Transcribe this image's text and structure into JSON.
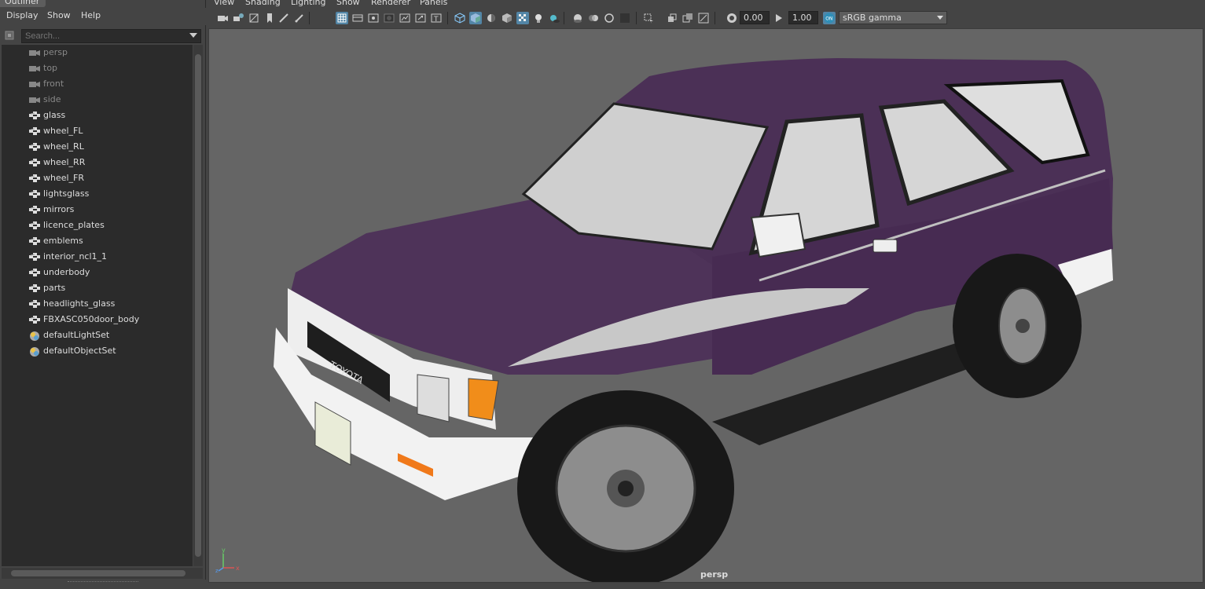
{
  "outliner": {
    "tab_title": "Outliner",
    "menu": [
      "Display",
      "Show",
      "Help"
    ],
    "search_placeholder": "Search...",
    "items": [
      {
        "label": "persp",
        "icon": "camera-icon",
        "dim": true
      },
      {
        "label": "top",
        "icon": "camera-icon",
        "dim": true
      },
      {
        "label": "front",
        "icon": "camera-icon",
        "dim": true
      },
      {
        "label": "side",
        "icon": "camera-icon",
        "dim": true
      },
      {
        "label": "glass",
        "icon": "transform-group-icon",
        "dim": false
      },
      {
        "label": "wheel_FL",
        "icon": "transform-group-icon",
        "dim": false
      },
      {
        "label": "wheel_RL",
        "icon": "transform-group-icon",
        "dim": false
      },
      {
        "label": "wheel_RR",
        "icon": "transform-group-icon",
        "dim": false
      },
      {
        "label": "wheel_FR",
        "icon": "transform-group-icon",
        "dim": false
      },
      {
        "label": "lightsglass",
        "icon": "transform-group-icon",
        "dim": false
      },
      {
        "label": "mirrors",
        "icon": "transform-group-icon",
        "dim": false
      },
      {
        "label": "licence_plates",
        "icon": "transform-group-icon",
        "dim": false
      },
      {
        "label": "emblems",
        "icon": "transform-group-icon",
        "dim": false
      },
      {
        "label": "interior_ncl1_1",
        "icon": "transform-group-icon",
        "dim": false
      },
      {
        "label": "underbody",
        "icon": "transform-group-icon",
        "dim": false
      },
      {
        "label": "parts",
        "icon": "transform-group-icon",
        "dim": false
      },
      {
        "label": "headlights_glass",
        "icon": "transform-group-icon",
        "dim": false
      },
      {
        "label": "FBXASC050door_body",
        "icon": "transform-group-icon",
        "dim": false
      },
      {
        "label": "defaultLightSet",
        "icon": "set-icon",
        "dim": false
      },
      {
        "label": "defaultObjectSet",
        "icon": "set-icon",
        "dim": false
      }
    ]
  },
  "viewport": {
    "menu": [
      "View",
      "Shading",
      "Lighting",
      "Show",
      "Renderer",
      "Panels"
    ],
    "exposure": "0.00",
    "gamma": "1.00",
    "color_space": "sRGB gamma",
    "camera_label": "persp"
  },
  "colors": {
    "panel_bg": "#444444",
    "viewport_bg": "#656565",
    "car_body": "#4b3056",
    "accent_active": "#5285a6"
  }
}
